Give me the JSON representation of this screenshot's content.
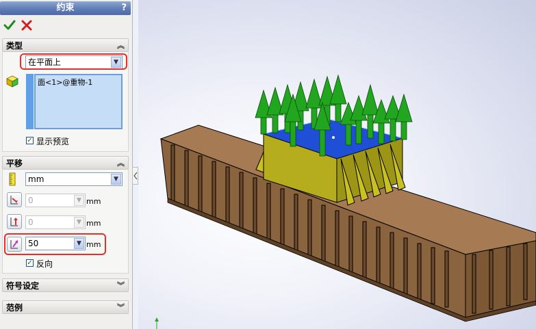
{
  "window": {
    "title": "约束",
    "help": "?"
  },
  "toolbar": {
    "ok_icon": "check-icon",
    "cancel_icon": "close-icon",
    "ok_color": "#1f8a1f",
    "cancel_color": "#d21d1d"
  },
  "type_section": {
    "header": "类型",
    "type_value": "在平面上",
    "selection_item": "面<1>@重物-1",
    "show_preview_label": "显示预览",
    "show_preview_checked": true
  },
  "translate_section": {
    "header": "平移",
    "unit_value": "mm",
    "field1": {
      "value": "0",
      "unit": "mm"
    },
    "field2": {
      "value": "0",
      "unit": "mm"
    },
    "field3": {
      "value": "50",
      "unit": "mm"
    },
    "reverse_label": "反向",
    "reverse_checked": true
  },
  "symbol_section": {
    "header": "符号设定"
  },
  "example_section": {
    "header": "范例"
  },
  "viewport": {
    "arrow_color": "#22a61f",
    "block_color": "#b5ad1e",
    "face_color": "#1f4fd6",
    "beam_color": "#946e47"
  }
}
